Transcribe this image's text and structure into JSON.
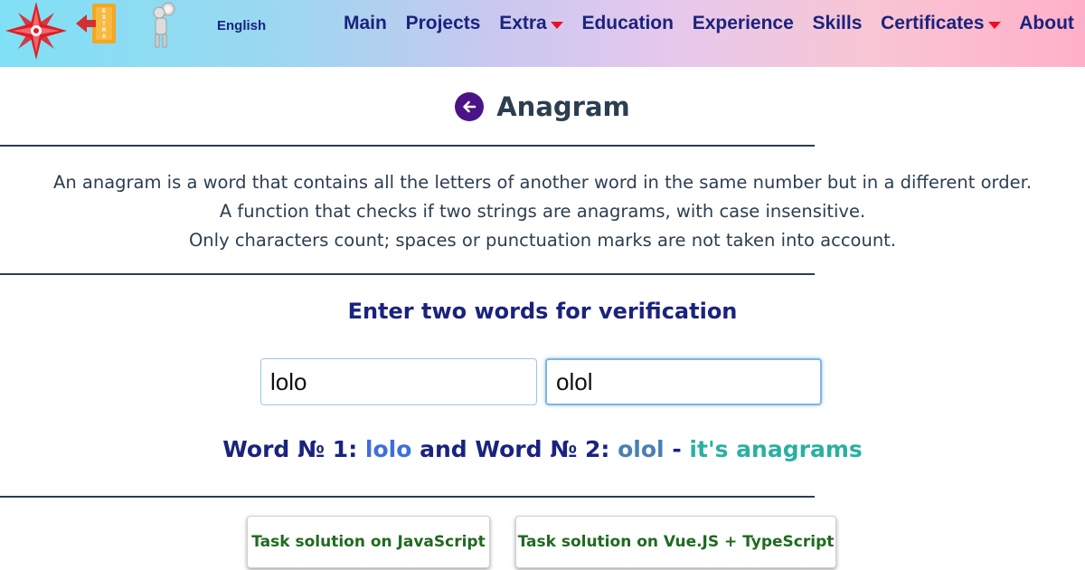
{
  "header": {
    "language": "English",
    "nav": [
      {
        "label": "Main",
        "dropdown": false
      },
      {
        "label": "Projects",
        "dropdown": false
      },
      {
        "label": "Extra",
        "dropdown": true
      },
      {
        "label": "Education",
        "dropdown": false
      },
      {
        "label": "Experience",
        "dropdown": false
      },
      {
        "label": "Skills",
        "dropdown": false
      },
      {
        "label": "Certificates",
        "dropdown": true
      },
      {
        "label": "About",
        "dropdown": false
      }
    ],
    "extra_icon_text": "EXTRA"
  },
  "page": {
    "title": "Anagram",
    "description": [
      "An anagram is a word that contains all the letters of another word in the same number but in a different order.",
      "A function that checks if two strings are anagrams, with case insensitive.",
      "Only characters count; spaces or punctuation marks are not taken into account."
    ],
    "form_heading": "Enter two words for verification",
    "input1_value": "lolo",
    "input2_value": "olol",
    "result": {
      "prefix1": "Word № 1:",
      "word1": "lolo",
      "middle": "and Word № 2:",
      "word2": "olol",
      "dash": "-",
      "verdict": "it's anagrams"
    },
    "buttons": {
      "js": "Task solution on JavaScript",
      "vue": "Task solution on Vue.JS + TypeScript"
    }
  },
  "colors": {
    "nav_text": "#1a237e",
    "caret": "#e8102a",
    "back_icon": "#4a1486",
    "word1": "#3f6fd8",
    "word2": "#4a7fb0",
    "verdict": "#2ab0a0",
    "button_text": "#1f6b1f"
  },
  "icons": [
    "compass-star-icon",
    "extra-exit-icon",
    "magnifier-man-icon",
    "back-arrow-icon",
    "caret-down-icon"
  ]
}
